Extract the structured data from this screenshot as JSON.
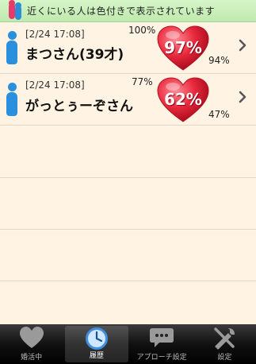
{
  "banner": {
    "text": "近くにいる人は色付きで表示されています",
    "icon": "people-icon"
  },
  "rows": [
    {
      "timestamp": "[2/24 17:08]",
      "name": "まつさん(39才)",
      "percent_top": "100%",
      "heart_percent": "97%",
      "percent_bottom": "94%"
    },
    {
      "timestamp": "[2/24 17:08]",
      "name": "がっとぅーぞさん",
      "percent_top": "77%",
      "heart_percent": "62%",
      "percent_bottom": "47%"
    }
  ],
  "tabs": [
    {
      "label": "婚活中",
      "icon": "heart-icon",
      "active": false
    },
    {
      "label": "履歴",
      "icon": "clock-icon",
      "active": true
    },
    {
      "label": "アプローチ設定",
      "icon": "speech-bubble-icon",
      "active": false
    },
    {
      "label": "設定",
      "icon": "tools-icon",
      "active": false
    }
  ],
  "colors": {
    "accent_blue": "#2a90de",
    "heart_red": "#e8283c",
    "banner_green": "#c9efb8",
    "background": "#fff3e3"
  }
}
